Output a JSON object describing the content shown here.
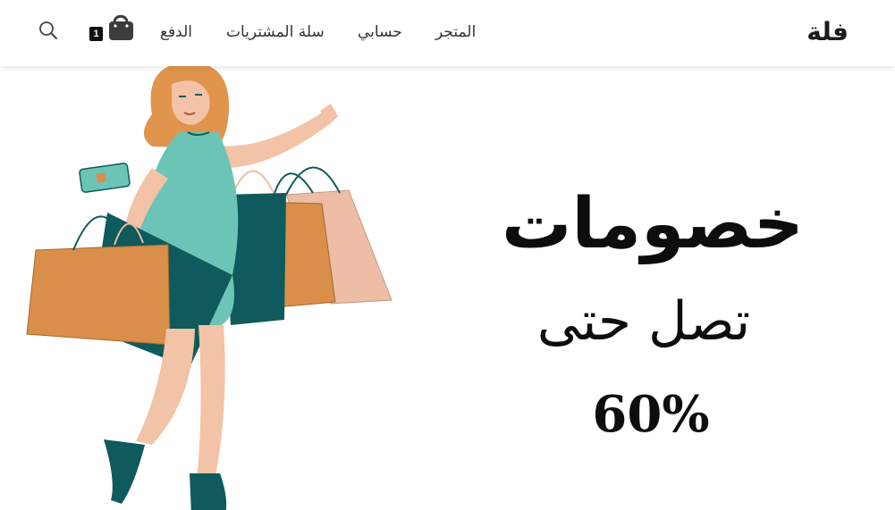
{
  "header": {
    "logo": "فلة",
    "nav": {
      "shop": "المتجر",
      "account": "حسابي",
      "cart": "سلة المشتريات",
      "checkout": "الدفع"
    },
    "cart_count": "1",
    "icons": {
      "cart": "shopping-bag-icon",
      "search": "search-icon"
    }
  },
  "hero": {
    "headline": "خصومات",
    "subline": "تصل حتى",
    "discount": "60%",
    "illustration": "woman-with-shopping-bags",
    "colors": {
      "dress": "#6cc4b6",
      "dark_teal": "#0e5a5c",
      "hair": "#e0944c",
      "bag_orange": "#d98f4a",
      "bag_pink": "#eebda6",
      "skin": "#f2c3a6"
    }
  }
}
